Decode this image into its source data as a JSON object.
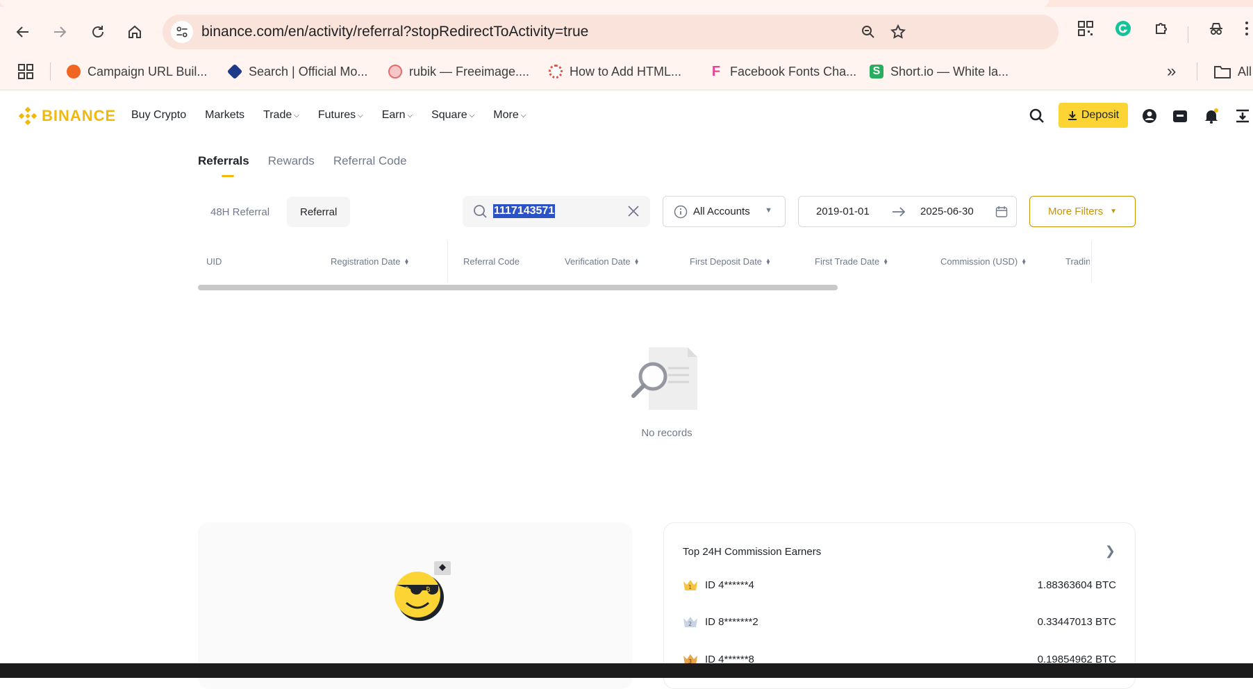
{
  "browser": {
    "url": "binance.com/en/activity/referral?stopRedirectToActivity=true",
    "bookmarks": [
      {
        "label": "Campaign URL Buil...",
        "color": "#f06522"
      },
      {
        "label": "Search | Official Mo...",
        "color": "#1d3a8a"
      },
      {
        "label": "rubik — Freeimage....",
        "color": "#e56b6f"
      },
      {
        "label": "How to Add HTML...",
        "color": "#e74c3c"
      },
      {
        "label": "Facebook Fonts Cha...",
        "color": "#e84393"
      },
      {
        "label": "Short.io — White la...",
        "color": "#27ae60"
      }
    ],
    "overflow_label": "»",
    "all_bookmarks_label": "All"
  },
  "header": {
    "logo": "BINANCE",
    "nav": [
      "Buy Crypto",
      "Markets",
      "Trade",
      "Futures",
      "Earn",
      "Square",
      "More"
    ],
    "deposit_label": "Deposit",
    "brand_color": "#f0b90b"
  },
  "subtabs": [
    "Referrals",
    "Rewards",
    "Referral Code"
  ],
  "filters": {
    "segments": [
      "48H Referral",
      "Referral"
    ],
    "search_value": "1117143571",
    "account_select": "All Accounts",
    "date_from": "2019-01-01",
    "date_to": "2025-06-30",
    "more_filters": "More Filters"
  },
  "table": {
    "columns": [
      "UID",
      "Registration Date",
      "Referral Code",
      "Verification Date",
      "First Deposit Date",
      "First Trade Date",
      "Commission (USD)",
      "Tradin"
    ],
    "empty_text": "No records"
  },
  "earners": {
    "title": "Top 24H Commission Earners",
    "items": [
      {
        "rank": "1",
        "id": "ID 4******4",
        "amount": "1.88363604 BTC"
      },
      {
        "rank": "2",
        "id": "ID 8*******2",
        "amount": "0.33447013 BTC"
      },
      {
        "rank": "3",
        "id": "ID 4******8",
        "amount": "0.19854962 BTC"
      }
    ]
  }
}
